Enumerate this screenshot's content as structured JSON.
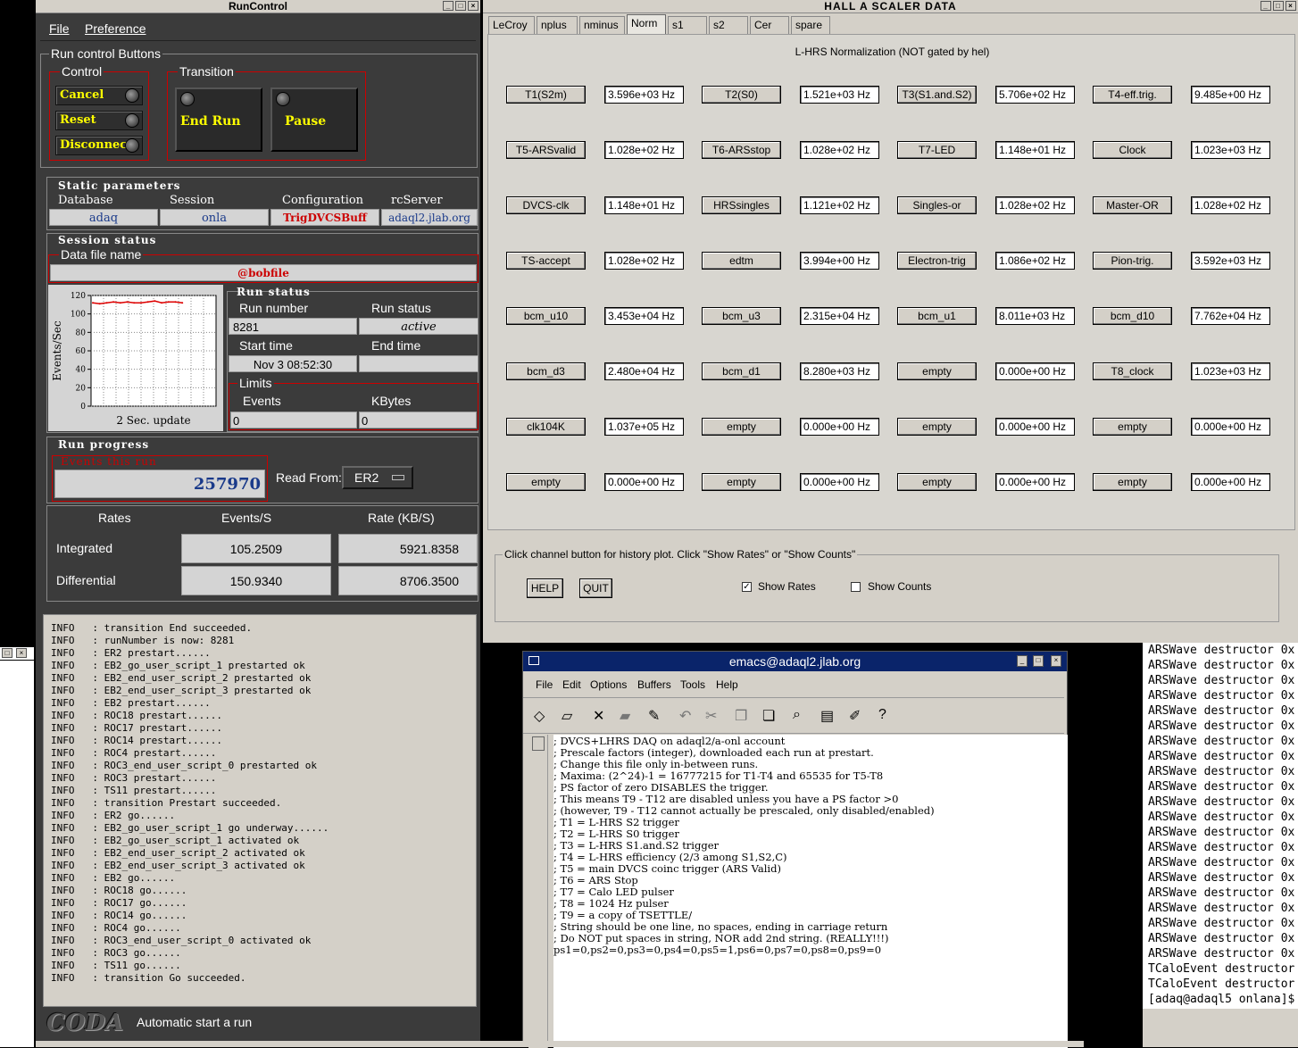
{
  "runcontrol": {
    "title": "RunControl",
    "menu": [
      "File",
      "Preference"
    ],
    "buttons_group": "Run control Buttons",
    "control_group": "Control",
    "control_buttons": [
      "Cancel",
      "Reset",
      "Disconnect"
    ],
    "transition_group": "Transition",
    "transition_buttons": [
      "End Run",
      "Pause"
    ],
    "static": {
      "title": "Static parameters",
      "database_label": "Database",
      "database": "adaq",
      "session_label": "Session",
      "session": "onla",
      "config_label": "Configuration",
      "config": "TrigDVCSBuff",
      "server_label": "rcServer",
      "server": "adaql2.jlab.org"
    },
    "session_status": {
      "title": "Session status",
      "data_file_label": "Data file name",
      "data_file": "@bobfile"
    },
    "plot": {
      "ylabel": "Events/Sec",
      "xlabel": "2 Sec. update",
      "yticks": [
        "120",
        "100",
        "80",
        "60",
        "40",
        "20",
        "0"
      ]
    },
    "chart_data": {
      "type": "line",
      "ylabel": "Events/Sec",
      "xlabel": "2 Sec. update",
      "ylim": [
        0,
        120
      ],
      "grid": true,
      "series": [
        {
          "values": [
            112,
            111,
            112,
            113,
            112,
            113,
            112,
            112,
            113,
            114,
            112,
            113,
            113,
            112
          ]
        }
      ]
    },
    "run_status": {
      "title": "Run status",
      "run_number_label": "Run number",
      "run_number": "8281",
      "status_label": "Run status",
      "status": "active",
      "start_label": "Start time",
      "start": "Nov 3 08:52:30",
      "end_label": "End time",
      "end": ""
    },
    "limits": {
      "title": "Limits",
      "events_label": "Events",
      "events": "0",
      "kbytes_label": "KBytes",
      "kbytes": "0"
    },
    "progress": {
      "title": "Run progress",
      "events_label": "Events this run",
      "events": "257970",
      "read_from_label": "Read From:",
      "read_from": "ER2"
    },
    "rates": {
      "col0": "Rates",
      "col1": "Events/S",
      "col2": "Rate (KB/S)",
      "rows": [
        {
          "label": "Integrated",
          "events": "105.2509",
          "kb": "5921.8358"
        },
        {
          "label": "Differential",
          "events": "150.9340",
          "kb": "8706.3500"
        }
      ]
    },
    "log": [
      "INFO   : transition End succeeded.",
      "INFO   : runNumber is now: 8281",
      "INFO   : ER2 prestart......",
      "INFO   : EB2_go_user_script_1 prestarted ok",
      "INFO   : EB2_end_user_script_2 prestarted ok",
      "INFO   : EB2_end_user_script_3 prestarted ok",
      "INFO   : EB2 prestart......",
      "INFO   : ROC18 prestart......",
      "INFO   : ROC17 prestart......",
      "INFO   : ROC14 prestart......",
      "INFO   : ROC4 prestart......",
      "INFO   : ROC3_end_user_script_0 prestarted ok",
      "INFO   : ROC3 prestart......",
      "INFO   : TS11 prestart......",
      "INFO   : transition Prestart succeeded.",
      "INFO   : ER2 go......",
      "INFO   : EB2_go_user_script_1 go underway......",
      "INFO   : EB2_go_user_script_1 activated ok",
      "INFO   : EB2_end_user_script_2 activated ok",
      "INFO   : EB2_end_user_script_3 activated ok",
      "INFO   : EB2 go......",
      "INFO   : ROC18 go......",
      "INFO   : ROC17 go......",
      "INFO   : ROC14 go......",
      "INFO   : ROC4 go......",
      "INFO   : ROC3_end_user_script_0 activated ok",
      "INFO   : ROC3 go......",
      "INFO   : TS11 go......",
      "INFO   : transition Go succeeded."
    ],
    "footer_logo": "CODA",
    "footer_text": "Automatic start a run"
  },
  "scaler": {
    "title": "HALL  A  SCALER  DATA",
    "tabs": [
      "LeCroy",
      "nplus",
      "nminus",
      "Norm",
      "s1",
      "s2",
      "Cer",
      "spare"
    ],
    "selected_tab": "Norm",
    "heading": "L-HRS Normalization (NOT gated by hel)",
    "grid": [
      [
        [
          "T1(S2m)",
          "3.596e+03 Hz"
        ],
        [
          "T2(S0)",
          "1.521e+03 Hz"
        ],
        [
          "T3(S1.and.S2)",
          "5.706e+02 Hz"
        ],
        [
          "T4-eff.trig.",
          "9.485e+00 Hz"
        ]
      ],
      [
        [
          "T5-ARSvalid",
          "1.028e+02 Hz"
        ],
        [
          "T6-ARSstop",
          "1.028e+02 Hz"
        ],
        [
          "T7-LED",
          "1.148e+01 Hz"
        ],
        [
          "Clock",
          "1.023e+03 Hz"
        ]
      ],
      [
        [
          "DVCS-clk",
          "1.148e+01 Hz"
        ],
        [
          "HRSsingles",
          "1.121e+02 Hz"
        ],
        [
          "Singles-or",
          "1.028e+02 Hz"
        ],
        [
          "Master-OR",
          "1.028e+02 Hz"
        ]
      ],
      [
        [
          "TS-accept",
          "1.028e+02 Hz"
        ],
        [
          "edtm",
          "3.994e+00 Hz"
        ],
        [
          "Electron-trig",
          "1.086e+02 Hz"
        ],
        [
          "Pion-trig.",
          "3.592e+03 Hz"
        ]
      ],
      [
        [
          "bcm_u10",
          "3.453e+04 Hz"
        ],
        [
          "bcm_u3",
          "2.315e+04 Hz"
        ],
        [
          "bcm_u1",
          "8.011e+03 Hz"
        ],
        [
          "bcm_d10",
          "7.762e+04 Hz"
        ]
      ],
      [
        [
          "bcm_d3",
          "2.480e+04 Hz"
        ],
        [
          "bcm_d1",
          "8.280e+03 Hz"
        ],
        [
          "empty",
          "0.000e+00 Hz"
        ],
        [
          "T8_clock",
          "1.023e+03 Hz"
        ]
      ],
      [
        [
          "clk104K",
          "1.037e+05 Hz"
        ],
        [
          "empty",
          "0.000e+00 Hz"
        ],
        [
          "empty",
          "0.000e+00 Hz"
        ],
        [
          "empty",
          "0.000e+00 Hz"
        ]
      ],
      [
        [
          "empty",
          "0.000e+00 Hz"
        ],
        [
          "empty",
          "0.000e+00 Hz"
        ],
        [
          "empty",
          "0.000e+00 Hz"
        ],
        [
          "empty",
          "0.000e+00 Hz"
        ]
      ]
    ],
    "hint": "Click channel button for history plot.  Click \"Show Rates\" or \"Show Counts\"",
    "help": "HELP",
    "quit": "QUIT",
    "show_rates": "Show Rates",
    "show_counts": "Show Counts"
  },
  "emacs": {
    "title": "emacs@adaql2.jlab.org",
    "menu": [
      "File",
      "Edit",
      "Options",
      "Buffers",
      "Tools",
      "Help"
    ],
    "lines": [
      "; DVCS+LHRS DAQ on adaql2/a-onl account",
      "; Prescale factors (integer), downloaded each run at prestart.",
      "; Change this file only in-between runs.",
      "; Maxima: (2^24)-1 = 16777215 for T1-T4 and 65535 for T5-T8",
      "; PS factor of zero DISABLES the trigger.",
      "; This means T9 - T12 are disabled unless you have a PS factor >0",
      "; (however, T9 - T12 cannot actually be prescaled, only disabled/enabled)",
      "; T1 = L-HRS S2 trigger",
      "; T2 = L-HRS S0 trigger",
      "; T3 = L-HRS S1.and.S2 trigger",
      "; T4 = L-HRS efficiency (2/3 among S1,S2,C)",
      "; T5 = main DVCS coinc trigger (ARS Valid)",
      "; T6 = ARS Stop",
      "; T7 = Calo LED pulser",
      "; T8 = 1024 Hz pulser",
      "; T9 = a copy of TSETTLE/",
      "; String should be one line, no spaces, ending in carriage return",
      "; Do NOT put spaces in string, NOR add 2nd string. (REALLY!!!)",
      "",
      "",
      "ps1=0,ps2=0,ps3=0,ps4=0,ps5=1,ps6=0,ps7=0,ps8=0,ps9=0"
    ]
  },
  "terminal": {
    "lines": [
      "ARSWave destructor 0x",
      "ARSWave destructor 0x",
      "ARSWave destructor 0x",
      "ARSWave destructor 0x",
      "ARSWave destructor 0x",
      "ARSWave destructor 0x",
      "ARSWave destructor 0x",
      "ARSWave destructor 0x",
      "ARSWave destructor 0x",
      "ARSWave destructor 0x",
      "ARSWave destructor 0x",
      "ARSWave destructor 0x",
      "ARSWave destructor 0x",
      "ARSWave destructor 0x",
      "ARSWave destructor 0x",
      "ARSWave destructor 0x",
      "ARSWave destructor 0x",
      "ARSWave destructor 0x",
      "ARSWave destructor 0x",
      "ARSWave destructor 0x",
      "ARSWave destructor 0x",
      "TCaloEvent destructor",
      "TCaloEvent destructor",
      "[adaq@adaql5 onlana]$"
    ]
  }
}
